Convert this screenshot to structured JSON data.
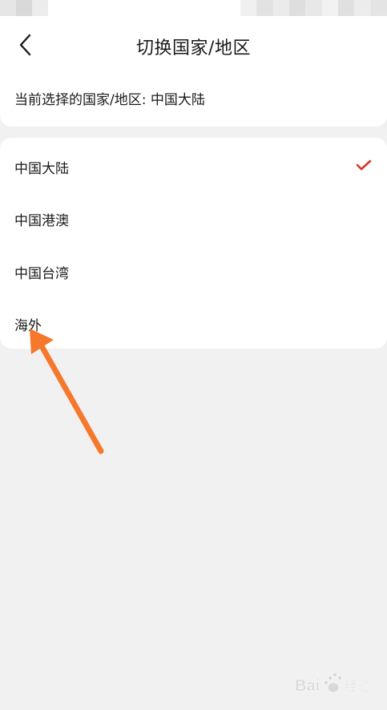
{
  "header": {
    "back_icon": "chevron-left-icon",
    "title": "切换国家/地区",
    "current_region_text": "当前选择的国家/地区: 中国大陆"
  },
  "regions": [
    {
      "label": "中国大陆",
      "selected": true
    },
    {
      "label": "中国港澳",
      "selected": false
    },
    {
      "label": "中国台湾",
      "selected": false
    },
    {
      "label": "海外",
      "selected": false
    }
  ],
  "colors": {
    "accent_check": "#d9342b",
    "annotation_arrow": "#f5782b",
    "background": "#f1f1f1",
    "card": "#ffffff"
  },
  "watermark": {
    "text": "Bai 经验"
  }
}
